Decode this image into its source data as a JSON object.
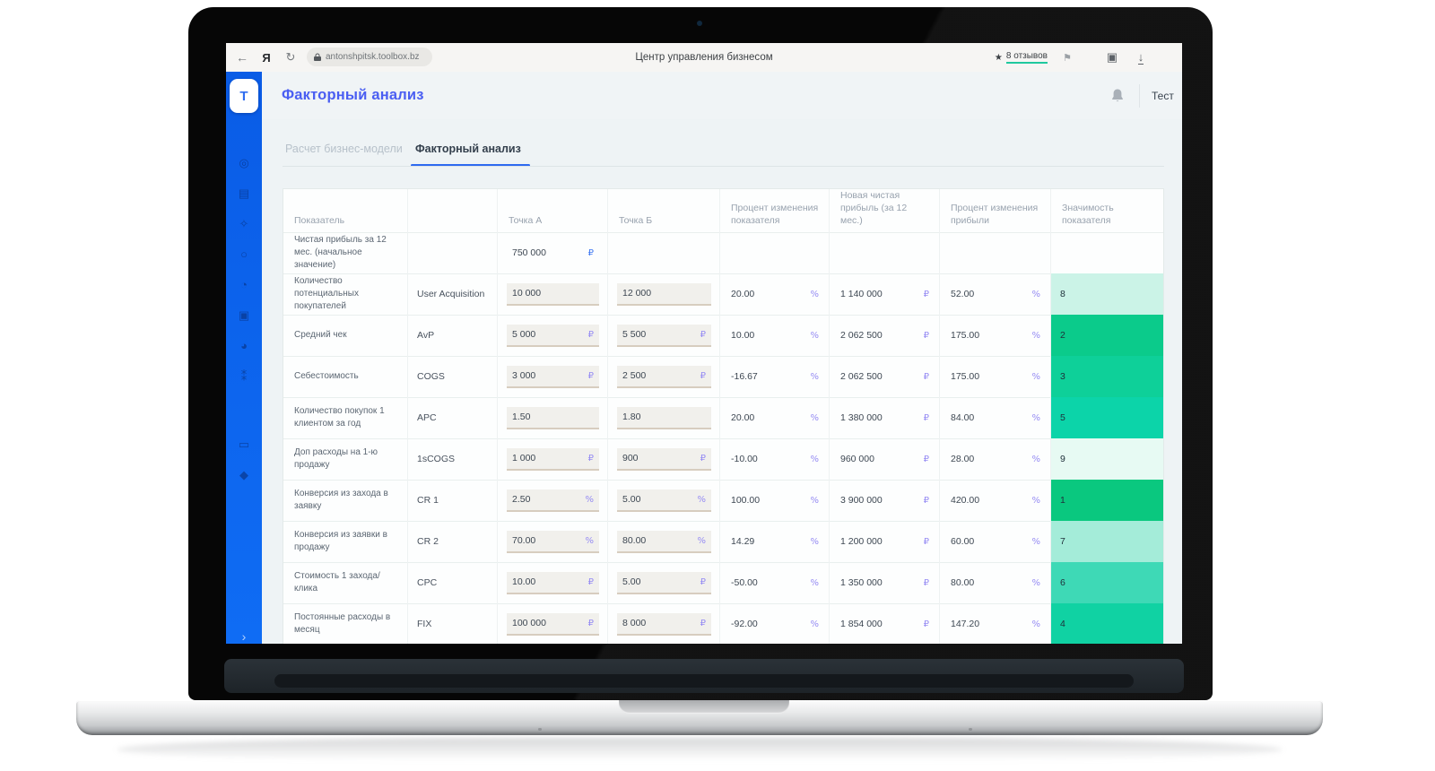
{
  "browser": {
    "back": "←",
    "yandex_logo": "Я",
    "reload": "↻",
    "url": "antonshpitsk.toolbox.bz",
    "page_title": "Центр управления бизнесом",
    "reviews_star": "★",
    "reviews_label": "8 отзывов",
    "bookmark_glyph": "⚑",
    "collections_glyph": "▣",
    "download_glyph": "↓"
  },
  "sidebar": {
    "logo": "T",
    "icons": [
      {
        "name": "target-icon",
        "glyph": "◎"
      },
      {
        "name": "list-icon",
        "glyph": "▤"
      },
      {
        "name": "idea-icon",
        "glyph": "✧"
      },
      {
        "name": "circle-icon",
        "glyph": "○"
      },
      {
        "name": "pie-chart-icon",
        "glyph": "◔"
      },
      {
        "name": "image-chart-icon",
        "glyph": "▣"
      },
      {
        "name": "pie-chart2-icon",
        "glyph": "◕"
      },
      {
        "name": "users-icon",
        "glyph": "⁑"
      },
      {
        "name": "card-icon",
        "glyph": "▭"
      },
      {
        "name": "gem-icon",
        "glyph": "◆"
      }
    ],
    "expand_chevron": "›"
  },
  "header": {
    "title": "Факторный анализ",
    "user_name": "Тест",
    "avatar_letter": "T"
  },
  "tabs": [
    {
      "label": "Расчет бизнес-модели",
      "active": false
    },
    {
      "label": "Факторный анализ",
      "active": true
    }
  ],
  "table": {
    "columns": [
      "Показатель",
      "",
      "Точка А",
      "Точка Б",
      "Процент изменения показателя",
      "Новая чистая прибыль (за 12 мес.)",
      "Процент изменения прибыли",
      "Значимость показателя"
    ],
    "rows": [
      {
        "label": "Чистая прибыль за 12 мес. (начальное значение)",
        "code": "",
        "a": {
          "v": "750 000",
          "u": "₽",
          "box": false
        },
        "b": {
          "v": "",
          "u": "",
          "box": false
        },
        "pct": {
          "v": "",
          "u": ""
        },
        "profit": {
          "v": "",
          "u": ""
        },
        "ppct": {
          "v": "",
          "u": ""
        },
        "rank": "",
        "rank_color": ""
      },
      {
        "label": "Количество потенциальных покупателей",
        "code": "User Acquisition",
        "a": {
          "v": "10 000",
          "u": "",
          "box": true
        },
        "b": {
          "v": "12 000",
          "u": "",
          "box": true
        },
        "pct": {
          "v": "20.00",
          "u": "%"
        },
        "profit": {
          "v": "1 140 000",
          "u": "₽"
        },
        "ppct": {
          "v": "52.00",
          "u": "%"
        },
        "rank": "8",
        "rank_color": "#cbf3e7"
      },
      {
        "label": "Средний чек",
        "code": "AvP",
        "a": {
          "v": "5 000",
          "u": "₽",
          "box": true
        },
        "b": {
          "v": "5 500",
          "u": "₽",
          "box": true
        },
        "pct": {
          "v": "10.00",
          "u": "%"
        },
        "profit": {
          "v": "2 062 500",
          "u": "₽"
        },
        "ppct": {
          "v": "175.00",
          "u": "%"
        },
        "rank": "2",
        "rank_color": "#0bcb8b"
      },
      {
        "label": "Себестоимость",
        "code": "COGS",
        "a": {
          "v": "3 000",
          "u": "₽",
          "box": true
        },
        "b": {
          "v": "2 500",
          "u": "₽",
          "box": true
        },
        "pct": {
          "v": "-16.67",
          "u": "%"
        },
        "profit": {
          "v": "2 062 500",
          "u": "₽"
        },
        "ppct": {
          "v": "175.00",
          "u": "%"
        },
        "rank": "3",
        "rank_color": "#0ed099"
      },
      {
        "label": "Количество покупок 1 клиентом за год",
        "code": "APC",
        "a": {
          "v": "1.50",
          "u": "",
          "box": true
        },
        "b": {
          "v": "1.80",
          "u": "",
          "box": true
        },
        "pct": {
          "v": "20.00",
          "u": "%"
        },
        "profit": {
          "v": "1 380 000",
          "u": "₽"
        },
        "ppct": {
          "v": "84.00",
          "u": "%"
        },
        "rank": "5",
        "rank_color": "#0cd4a9"
      },
      {
        "label": "Доп расходы на 1-ю продажу",
        "code": "1sCOGS",
        "a": {
          "v": "1 000",
          "u": "₽",
          "box": true
        },
        "b": {
          "v": "900",
          "u": "₽",
          "box": true
        },
        "pct": {
          "v": "-10.00",
          "u": "%"
        },
        "profit": {
          "v": "960 000",
          "u": "₽"
        },
        "ppct": {
          "v": "28.00",
          "u": "%"
        },
        "rank": "9",
        "rank_color": "#e7faf3"
      },
      {
        "label": "Конверсия из захода в заявку",
        "code": "CR 1",
        "a": {
          "v": "2.50",
          "u": "%",
          "box": true
        },
        "b": {
          "v": "5.00",
          "u": "%",
          "box": true
        },
        "pct": {
          "v": "100.00",
          "u": "%"
        },
        "profit": {
          "v": "3 900 000",
          "u": "₽"
        },
        "ppct": {
          "v": "420.00",
          "u": "%"
        },
        "rank": "1",
        "rank_color": "#0ac87f"
      },
      {
        "label": "Конверсия из заявки в продажу",
        "code": "CR 2",
        "a": {
          "v": "70.00",
          "u": "%",
          "box": true
        },
        "b": {
          "v": "80.00",
          "u": "%",
          "box": true
        },
        "pct": {
          "v": "14.29",
          "u": "%"
        },
        "profit": {
          "v": "1 200 000",
          "u": "₽"
        },
        "ppct": {
          "v": "60.00",
          "u": "%"
        },
        "rank": "7",
        "rank_color": "#a4ecd9"
      },
      {
        "label": "Стоимость 1 захода/клика",
        "code": "CPC",
        "a": {
          "v": "10.00",
          "u": "₽",
          "box": true
        },
        "b": {
          "v": "5.00",
          "u": "₽",
          "box": true
        },
        "pct": {
          "v": "-50.00",
          "u": "%"
        },
        "profit": {
          "v": "1 350 000",
          "u": "₽"
        },
        "ppct": {
          "v": "80.00",
          "u": "%"
        },
        "rank": "6",
        "rank_color": "#3ed9b6"
      },
      {
        "label": "Постоянные расходы в месяц",
        "code": "FIX",
        "a": {
          "v": "100 000",
          "u": "₽",
          "box": true
        },
        "b": {
          "v": "8 000",
          "u": "₽",
          "box": true
        },
        "pct": {
          "v": "-92.00",
          "u": "%"
        },
        "profit": {
          "v": "1 854 000",
          "u": "₽"
        },
        "ppct": {
          "v": "147.20",
          "u": "%"
        },
        "rank": "4",
        "rank_color": "#10d2a3"
      }
    ]
  },
  "colors": {
    "sidebar_blue": "#0d66ee",
    "title_blue": "#4a5ef2",
    "tab_underline": "#2e6af0",
    "reviews_underline": "#1fc89e",
    "chat_blue": "#1a76cb"
  }
}
